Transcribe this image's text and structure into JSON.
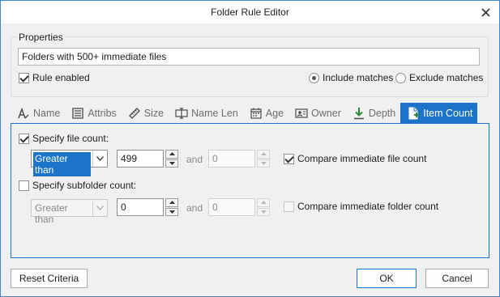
{
  "window": {
    "title": "Folder Rule Editor"
  },
  "properties": {
    "group_label": "Properties",
    "name_value": "Folders with 500+ immediate files",
    "rule_enabled_label": "Rule enabled",
    "rule_enabled": true,
    "include_label": "Include matches",
    "exclude_label": "Exclude matches",
    "selected_mode": "include"
  },
  "tabs": [
    {
      "label": "Name",
      "icon": "name-icon"
    },
    {
      "label": "Attribs",
      "icon": "attribs-icon"
    },
    {
      "label": "Size",
      "icon": "size-icon"
    },
    {
      "label": "Name Len",
      "icon": "name-len-icon"
    },
    {
      "label": "Age",
      "icon": "age-icon"
    },
    {
      "label": "Owner",
      "icon": "owner-icon"
    },
    {
      "label": "Depth",
      "icon": "depth-icon"
    },
    {
      "label": "Item Count",
      "icon": "item-count-icon",
      "active": true
    }
  ],
  "file_count": {
    "label": "Specify file count:",
    "checked": true,
    "operator": "Greater than",
    "value1": "499",
    "and_label": "and",
    "value2": "0",
    "compare_label": "Compare immediate file count",
    "compare_checked": true
  },
  "subfolder_count": {
    "label": "Specify subfolder count:",
    "checked": false,
    "operator": "Greater than",
    "value1": "0",
    "and_label": "and",
    "value2": "0",
    "compare_label": "Compare immediate folder count",
    "compare_checked": false
  },
  "buttons": {
    "reset": "Reset Criteria",
    "ok": "OK",
    "cancel": "Cancel"
  },
  "colors": {
    "accent": "#1c74c8",
    "window_border": "#3c88d6",
    "dialog_bg": "#f0f0f0"
  }
}
